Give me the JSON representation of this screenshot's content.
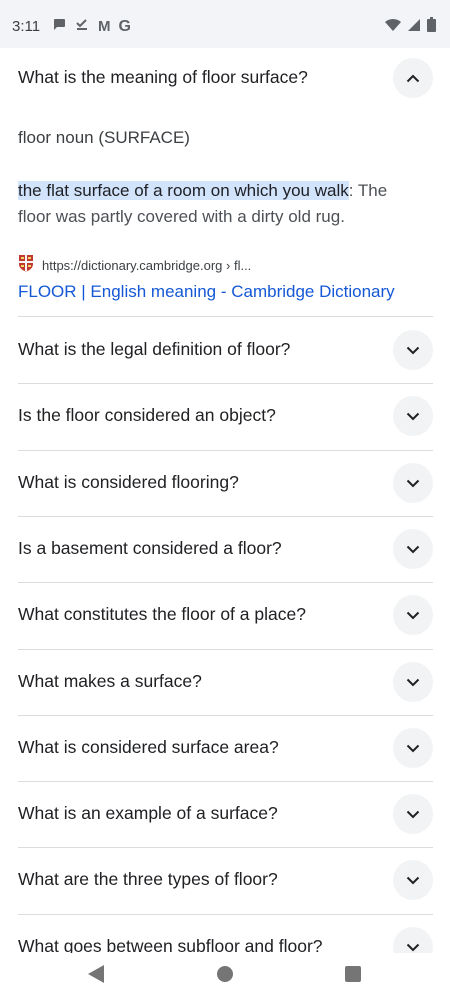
{
  "status_bar": {
    "time": "3:11",
    "left_icons": [
      "chat-bubble-icon",
      "checkmark-download-icon",
      "gmail-icon",
      "google-icon"
    ],
    "gmail_glyph": "M",
    "google_glyph": "G",
    "right_icons": [
      "wifi-icon",
      "cell-signal-icon",
      "battery-icon"
    ]
  },
  "expanded_question": {
    "text": "What is the meaning of floor surface?",
    "part_of_speech": "floor noun (SURFACE)",
    "definition_highlighted": "the flat surface of a room on which you walk",
    "definition_rest": ": The floor was partly covered with a dirty old rug.",
    "source_url": "https://dictionary.cambridge.org › fl...",
    "source_title": "FLOOR | English meaning - Cambridge Dictionary"
  },
  "questions": [
    "What is the legal definition of floor?",
    "Is the floor considered an object?",
    "What is considered flooring?",
    "Is a basement considered a floor?",
    "What constitutes the floor of a place?",
    "What makes a surface?",
    "What is considered surface area?",
    "What is an example of a surface?",
    "What are the three types of floor?",
    "What goes between subfloor and floor?"
  ],
  "colors": {
    "link": "#1558d6",
    "highlight": "#d2e3fc",
    "chevron_bg": "#f1f3f4",
    "status_bar_bg": "#f3f4f7"
  }
}
